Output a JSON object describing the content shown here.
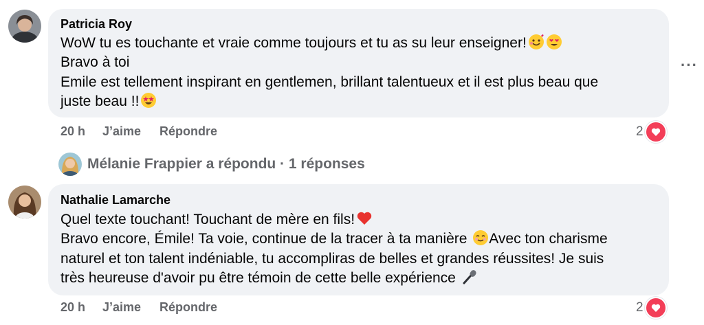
{
  "comments": [
    {
      "author": "Patricia Roy",
      "lines": [
        "WoW tu es touchante et vraie comme toujours et tu as su leur enseigner!",
        "Bravo à toi",
        "Emile est tellement inspirant en gentlemen, brillant talentueux et il est plus beau que",
        "juste beau !!"
      ],
      "time": "20 h",
      "like_label": "J’aime",
      "reply_label": "Répondre",
      "reaction_count": "2"
    },
    {
      "author": "Nathalie Lamarche",
      "lines": [
        "Quel texte touchant! Touchant de mère en fils!",
        "Bravo encore, Émile! Ta voie, continue de la tracer à ta manière",
        "Avec ton charisme",
        "naturel et ton talent indéniable, tu accompliras de belles et grandes réussites! Je suis",
        "très heureuse d'avoir pu être témoin de cette belle expérience"
      ],
      "time": "20 h",
      "like_label": "J’aime",
      "reply_label": "Répondre",
      "reaction_count": "2"
    }
  ],
  "replies_summary": "Mélanie Frappier a répondu · 1 réponses",
  "more_options": "···",
  "icons": {
    "reaction": "heart-icon",
    "more": "more-options-icon",
    "emojis": [
      "smiling-face-with-hearts-emoji",
      "heart-eyes-emoji",
      "star-struck-emoji",
      "red-heart-emoji",
      "smiling-face-emoji",
      "microphone-emoji"
    ]
  },
  "colors": {
    "bubble": "#f0f2f5",
    "meta_text": "#65676b",
    "heart": "#f33e58"
  }
}
